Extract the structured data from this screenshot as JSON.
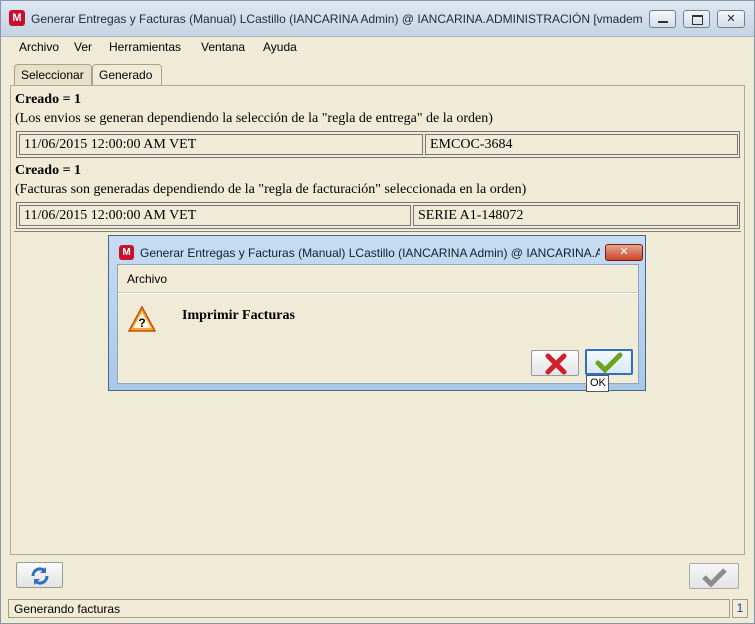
{
  "window": {
    "title": "Generar Entregas y Facturas (Manual)  LCastillo (IANCARINA Admin) @ IANCARINA.ADMINISTRACIÓN [vmadempi...",
    "app_icon_letter": "M"
  },
  "menu": {
    "items": [
      "Archivo",
      "Ver",
      "Herramientas",
      "Ventana",
      "Ayuda"
    ]
  },
  "tabs": [
    {
      "label": "Seleccionar",
      "active": false
    },
    {
      "label": "Generado",
      "active": true
    }
  ],
  "results": [
    {
      "header": "Creado = 1",
      "description": "(Los envios se generan dependiendo la selección de la \"regla de entrega\" de la orden)",
      "date": "11/06/2015 12:00:00 AM VET",
      "document": "EMCOC-3684"
    },
    {
      "header": "Creado = 1",
      "description": "(Facturas son generadas dependiendo de la \"regla de facturación\" seleccionada en la orden)",
      "date": "11/06/2015 12:00:00 AM VET",
      "document": "SERIE A1-148072"
    }
  ],
  "dialog": {
    "title": "Generar Entregas y Facturas (Manual)  LCastillo (IANCARINA Admin) @ IANCARINA.A...",
    "icon_letter": "M",
    "menu_label": "Archivo",
    "message": "Imprimir Facturas",
    "icons": {
      "warning": "warning-icon",
      "cancel": "red-x-icon",
      "ok": "green-check-icon"
    },
    "ok_tooltip": "OK"
  },
  "status": {
    "text": "Generando facturas",
    "count": "1"
  },
  "colors": {
    "background": "#efebd7",
    "dialog_border": "#3e6a92",
    "brand_red": "#c8102e"
  }
}
